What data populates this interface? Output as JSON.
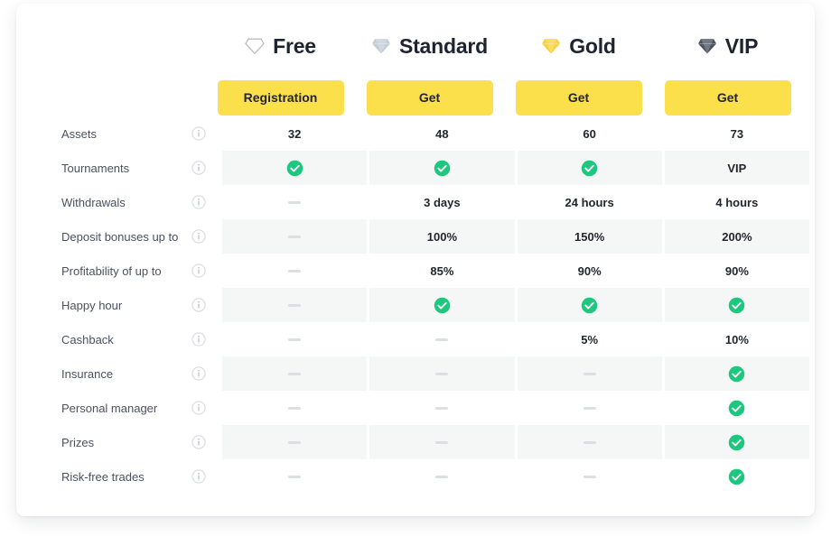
{
  "plans": [
    {
      "name": "Free",
      "icon": "diamond-outline-icon",
      "gem_color": "#b9bcc2",
      "cta": "Registration"
    },
    {
      "name": "Standard",
      "icon": "diamond-silver-icon",
      "gem_color": "#c3ccd8",
      "cta": "Get"
    },
    {
      "name": "Gold",
      "icon": "diamond-gold-icon",
      "gem_color": "#f7d13c",
      "cta": "Get"
    },
    {
      "name": "VIP",
      "icon": "diamond-black-icon",
      "gem_color": "#4a5160",
      "cta": "Get"
    }
  ],
  "features": [
    {
      "label": "Assets",
      "info": "info-icon",
      "striped": false,
      "values": [
        "32",
        "48",
        "60",
        "73"
      ]
    },
    {
      "label": "Tournaments",
      "info": "info-icon",
      "striped": true,
      "values": [
        "check",
        "check",
        "check",
        "VIP"
      ]
    },
    {
      "label": "Withdrawals",
      "info": "info-icon",
      "striped": false,
      "values": [
        "dash",
        "3 days",
        "24 hours",
        "4 hours"
      ]
    },
    {
      "label": "Deposit bonuses up to",
      "info": "info-icon",
      "striped": true,
      "values": [
        "dash",
        "100%",
        "150%",
        "200%"
      ]
    },
    {
      "label": "Profitability of up to",
      "info": "info-icon",
      "striped": false,
      "values": [
        "dash",
        "85%",
        "90%",
        "90%"
      ]
    },
    {
      "label": "Happy hour",
      "info": "info-icon",
      "striped": true,
      "values": [
        "dash",
        "check",
        "check",
        "check"
      ]
    },
    {
      "label": "Cashback",
      "info": "info-icon",
      "striped": false,
      "values": [
        "dash",
        "dash",
        "5%",
        "10%"
      ]
    },
    {
      "label": "Insurance",
      "info": "info-icon",
      "striped": true,
      "values": [
        "dash",
        "dash",
        "dash",
        "check"
      ]
    },
    {
      "label": "Personal manager",
      "info": "info-icon",
      "striped": false,
      "values": [
        "dash",
        "dash",
        "dash",
        "check"
      ]
    },
    {
      "label": "Prizes",
      "info": "info-icon",
      "striped": true,
      "values": [
        "dash",
        "dash",
        "dash",
        "check"
      ]
    },
    {
      "label": "Risk-free trades",
      "info": "info-icon",
      "striped": false,
      "values": [
        "dash",
        "dash",
        "dash",
        "check"
      ]
    }
  ],
  "colors": {
    "accent_button": "#fbdf4b",
    "check_green": "#1ec77e",
    "stripe": "#f5f6f6",
    "dash_gray": "#dcdfe2",
    "text_dark": "#22262e",
    "text_label": "#4b5160"
  }
}
